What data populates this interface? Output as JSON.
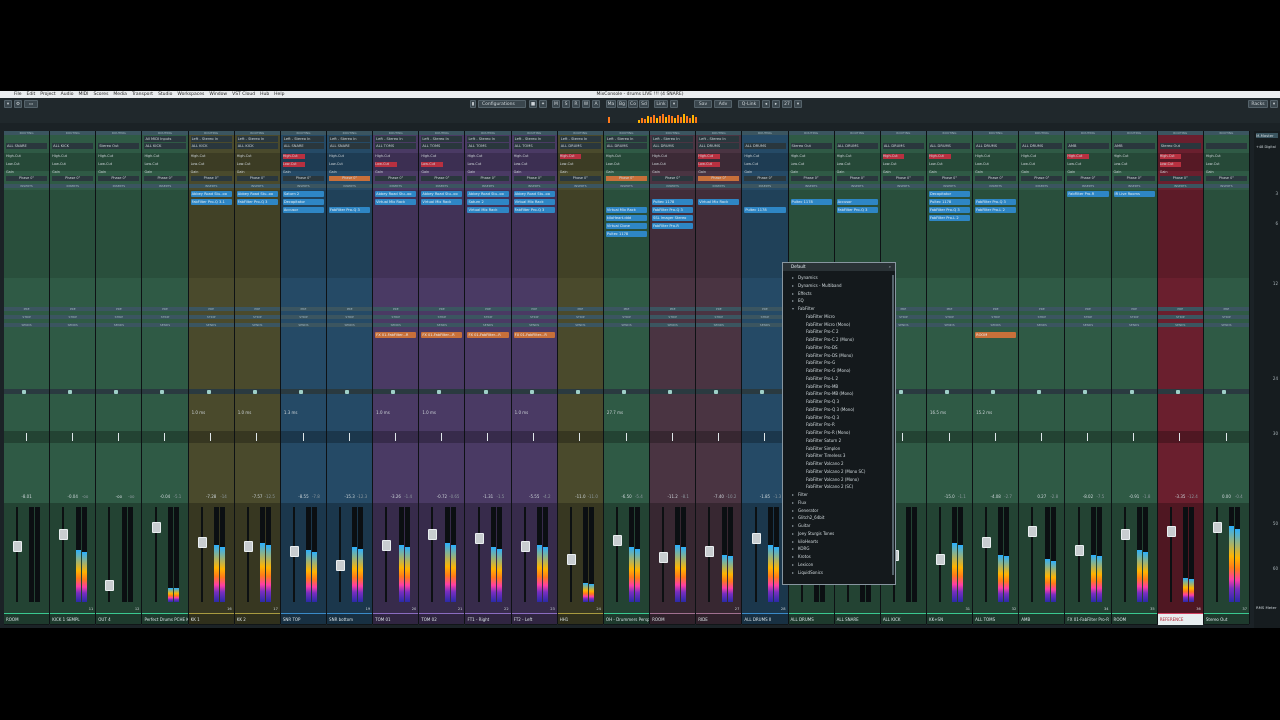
{
  "window": {
    "title": "MixConsole - drums LIVE !!! (4 SNARE)",
    "menu": [
      "File",
      "Edit",
      "Project",
      "Audio",
      "MIDI",
      "Scores",
      "Media",
      "Transport",
      "Studio",
      "Workspaces",
      "Window",
      "VST Cloud",
      "Hub",
      "Help"
    ]
  },
  "toolbar": {
    "configurations_label": "Configurations",
    "buttons": [
      "M",
      "S",
      "R",
      "W",
      "A"
    ],
    "right_label": "Racks",
    "link_label": "Link",
    "q_link_label": "Q-Link",
    "counter": "27",
    "group_labels": [
      "Ma",
      "Bg",
      "Co",
      "Sd"
    ],
    "window_buttons": [
      "Sav",
      "Adv"
    ],
    "meter_label": "Meter"
  },
  "colors": {
    "green": "#2f5a45",
    "green_dark": "#24463a",
    "olive": "#4a4a2c",
    "blue": "#254a66",
    "purple": "#4a3a64",
    "mauve": "#4a3442",
    "red": "#6a1f2e",
    "slot_blue": "#2e86c5",
    "slot_orange": "#c8703a",
    "red_cut": "#b83040"
  },
  "channels": [
    {
      "id": 1,
      "name": "ROOM",
      "routing": "ALL SNARE",
      "volume": "-8.01",
      "peak": "",
      "color": "green",
      "number": ""
    },
    {
      "id": 2,
      "name": "KICK 1 SEMPL",
      "routing": "ALL KICK",
      "volume": "-0.04",
      "peak": "-oo",
      "color": "green",
      "number": "11"
    },
    {
      "id": 3,
      "name": "OUT 4",
      "routing": "Stereo Out",
      "volume": "-oo",
      "peak": "-oo",
      "color": "green",
      "number": "12"
    },
    {
      "id": 4,
      "name": "Perfect Drums PCHE KICK",
      "routing": "ALL KICK",
      "input": "All MIDI Inputs",
      "volume": "-0.04",
      "peak": "-5.1",
      "color": "green",
      "number": ""
    },
    {
      "id": 5,
      "name": "KK 1",
      "routing": "ALL KICK",
      "input": "Left - Stereo In",
      "volume": "-7.28",
      "peak": "-14",
      "color": "olive",
      "number": "16"
    },
    {
      "id": 6,
      "name": "KK 2",
      "routing": "ALL KICK",
      "input": "Left - Stereo In",
      "volume": "-7.57",
      "peak": "-12.5",
      "color": "olive",
      "number": "17"
    },
    {
      "id": 7,
      "name": "SNR TOP",
      "routing": "ALL SNARE",
      "input": "Left - Stereo In",
      "volume": "-8.55",
      "peak": "-7.8",
      "color": "blue",
      "number": ""
    },
    {
      "id": 8,
      "name": "SNR bottom",
      "routing": "ALL SNARE",
      "input": "Left - Stereo In",
      "volume": "-15.3",
      "peak": "-12.3",
      "color": "blue",
      "number": "19"
    },
    {
      "id": 9,
      "name": "TOM 01",
      "routing": "ALL TOMS",
      "input": "Left - Stereo In",
      "volume": "-3.26",
      "peak": "-1.4",
      "color": "purple",
      "number": "20"
    },
    {
      "id": 10,
      "name": "TOM 02",
      "routing": "ALL TOMS",
      "input": "Left - Stereo In",
      "volume": "-0.72",
      "peak": "-0.65",
      "color": "purple",
      "number": "21"
    },
    {
      "id": 11,
      "name": "FT1 - Right",
      "routing": "ALL TOMS",
      "input": "Left - Stereo In",
      "volume": "-1.31",
      "peak": "-1.5",
      "color": "purple",
      "number": "22"
    },
    {
      "id": 12,
      "name": "FT2 - Left",
      "routing": "ALL TOMS",
      "input": "Left - Stereo In",
      "volume": "-5.55",
      "peak": "-4.2",
      "color": "purple",
      "number": "23"
    },
    {
      "id": 13,
      "name": "HH1",
      "routing": "ALL DRUMS",
      "input": "Left - Stereo In",
      "volume": "-11.0",
      "peak": "-11.0",
      "color": "olive",
      "number": "24"
    },
    {
      "id": 14,
      "name": "OH - Drummers Perspective",
      "routing": "ALL DRUMS",
      "input": "Left - Stereo In",
      "volume": "-6.50",
      "peak": "-5.4",
      "color": "green",
      "number": ""
    },
    {
      "id": 15,
      "name": "ROOM",
      "routing": "ALL DRUMS",
      "input": "Left - Stereo In",
      "volume": "-11.2",
      "peak": "-8.1",
      "color": "mauve",
      "number": ""
    },
    {
      "id": 16,
      "name": "RIDE",
      "routing": "ALL DRUMS",
      "input": "Left - Stereo In",
      "volume": "-7.40",
      "peak": "-10.2",
      "color": "mauve",
      "number": "27"
    },
    {
      "id": 17,
      "name": "ALL DRUMS II",
      "routing": "ALL DRUMS",
      "volume": "-1.85",
      "peak": "-1.3",
      "color": "blue",
      "number": "28"
    },
    {
      "id": 18,
      "name": "ALL DRUMS",
      "routing": "Stereo Out",
      "volume": "",
      "peak": "",
      "color": "green",
      "number": ""
    },
    {
      "id": 19,
      "name": "ALL SNARE",
      "routing": "ALL DRUMS",
      "volume": "",
      "peak": "",
      "color": "green",
      "number": ""
    },
    {
      "id": 20,
      "name": "ALL KICK",
      "routing": "ALL DRUMS",
      "volume": "",
      "peak": "",
      "color": "green",
      "number": ""
    },
    {
      "id": 21,
      "name": "KK+SN",
      "routing": "ALL DRUMS",
      "volume": "-15.0",
      "peak": "-1.1",
      "color": "green",
      "number": "31"
    },
    {
      "id": 22,
      "name": "ALL TOMS",
      "routing": "ALL DRUMS",
      "volume": "-4.08",
      "peak": "-2.7",
      "color": "green",
      "number": "32"
    },
    {
      "id": 23,
      "name": "AMB",
      "routing": "ALL DRUMS",
      "volume": "0.27",
      "peak": "-2.8",
      "color": "green",
      "number": ""
    },
    {
      "id": 24,
      "name": "FX 01-FabFilter Pro-R",
      "routing": "AMB",
      "volume": "-8.02",
      "peak": "-7.5",
      "color": "green",
      "number": "34"
    },
    {
      "id": 25,
      "name": "ROOM",
      "routing": "AMB",
      "volume": "-0.91",
      "peak": "-1.8",
      "color": "green",
      "number": "35"
    },
    {
      "id": 26,
      "name": "REFERENCE",
      "routing": "Stereo Out",
      "volume": "-3.35",
      "peak": "-12.4",
      "color": "red",
      "number": "36"
    },
    {
      "id": 27,
      "name": "Stereo Out",
      "routing": "",
      "volume": "0.00",
      "peak": "-0.4",
      "color": "green",
      "number": "37"
    }
  ],
  "insert_slots": [
    {
      "ch": 5,
      "row": 0,
      "label": "Abbey Road Stu..oo",
      "kind": "blue"
    },
    {
      "ch": 5,
      "row": 1,
      "label": "FabFilter Pro-Q 3-1",
      "kind": "blue"
    },
    {
      "ch": 6,
      "row": 0,
      "label": "Abbey Road Stu..oo",
      "kind": "blue"
    },
    {
      "ch": 6,
      "row": 1,
      "label": "FabFilter Pro-Q 3",
      "kind": "blue"
    },
    {
      "ch": 7,
      "row": 0,
      "label": "Saturn 2",
      "kind": "blue"
    },
    {
      "ch": 7,
      "row": 1,
      "label": "Decapitator",
      "kind": "blue"
    },
    {
      "ch": 7,
      "row": 2,
      "label": "Accusor",
      "kind": "blue"
    },
    {
      "ch": 8,
      "row": 2,
      "label": "FabFilter Pro-Q 3",
      "kind": "blue"
    },
    {
      "ch": 9,
      "row": 0,
      "label": "Abbey Road Stu..oo",
      "kind": "blue"
    },
    {
      "ch": 9,
      "row": 1,
      "label": "Virtual Mix Rack",
      "kind": "blue"
    },
    {
      "ch": 10,
      "row": 0,
      "label": "Abbey Road Stu..oo",
      "kind": "blue"
    },
    {
      "ch": 10,
      "row": 1,
      "label": "Virtual Mix Rack",
      "kind": "blue"
    },
    {
      "ch": 11,
      "row": 0,
      "label": "Abbey Road Stu..oo",
      "kind": "blue"
    },
    {
      "ch": 11,
      "row": 1,
      "label": "Saturn 2",
      "kind": "blue"
    },
    {
      "ch": 11,
      "row": 2,
      "label": "Virtual Mix Rack",
      "kind": "blue"
    },
    {
      "ch": 12,
      "row": 0,
      "label": "Abbey Road Stu..oo",
      "kind": "blue"
    },
    {
      "ch": 12,
      "row": 1,
      "label": "Virtual Mix Rack",
      "kind": "blue"
    },
    {
      "ch": 12,
      "row": 2,
      "label": "FabFilter Pro-Q 3",
      "kind": "blue"
    },
    {
      "ch": 14,
      "row": 2,
      "label": "Virtual Mix Rack",
      "kind": "blue"
    },
    {
      "ch": 14,
      "row": 3,
      "label": "kiloHeart.ddd",
      "kind": "blue"
    },
    {
      "ch": 14,
      "row": 4,
      "label": "Virtual Clone",
      "kind": "blue"
    },
    {
      "ch": 14,
      "row": 5,
      "label": "Pultec 1178",
      "kind": "blue"
    },
    {
      "ch": 15,
      "row": 1,
      "label": "Pultec 1178",
      "kind": "blue"
    },
    {
      "ch": 15,
      "row": 2,
      "label": "FabFilter Pro-Q 3",
      "kind": "blue"
    },
    {
      "ch": 15,
      "row": 3,
      "label": "SSL Imager Stereo",
      "kind": "blue"
    },
    {
      "ch": 15,
      "row": 4,
      "label": "FabFilter Pro-R",
      "kind": "blue"
    },
    {
      "ch": 16,
      "row": 1,
      "label": "Virtual Mix Rack",
      "kind": "blue"
    },
    {
      "ch": 17,
      "row": 2,
      "label": "Pultec 1178",
      "kind": "blue"
    },
    {
      "ch": 18,
      "row": 1,
      "label": "Pultec 1178",
      "kind": "blue"
    },
    {
      "ch": 19,
      "row": 1,
      "label": "Accusor",
      "kind": "blue"
    },
    {
      "ch": 19,
      "row": 2,
      "label": "FabFilter Pro-Q 3",
      "kind": "blue"
    },
    {
      "ch": 21,
      "row": 0,
      "label": "Decapitator",
      "kind": "blue"
    },
    {
      "ch": 21,
      "row": 1,
      "label": "Pultec 1178",
      "kind": "blue"
    },
    {
      "ch": 21,
      "row": 2,
      "label": "FabFilter Pro-Q 3",
      "kind": "blue"
    },
    {
      "ch": 21,
      "row": 3,
      "label": "FabFilter Pro-L 2",
      "kind": "blue"
    },
    {
      "ch": 22,
      "row": 1,
      "label": "FabFilter Pro-Q 3",
      "kind": "blue"
    },
    {
      "ch": 22,
      "row": 2,
      "label": "FabFilter Pro-L 2",
      "kind": "blue"
    },
    {
      "ch": 24,
      "row": 0,
      "label": "FabFilter Pro-R",
      "kind": "blue"
    },
    {
      "ch": 25,
      "row": 0,
      "label": "IR Live Rooms",
      "kind": "blue"
    }
  ],
  "send_slots": [
    {
      "ch": 9,
      "label": "FX 01-FabFilter...R"
    },
    {
      "ch": 10,
      "label": "FX 01-FabFilter...R"
    },
    {
      "ch": 11,
      "label": "FX 01-FabFilter...R"
    },
    {
      "ch": 12,
      "label": "FX 01-FabFilter...R"
    },
    {
      "ch": 22,
      "label": "ROOM"
    }
  ],
  "delay_labels": [
    {
      "ch": 5,
      "label": "1.0 ms"
    },
    {
      "ch": 6,
      "label": "1.0 ms"
    },
    {
      "ch": 7,
      "label": "1.3 ms"
    },
    {
      "ch": 9,
      "label": "1.0 ms"
    },
    {
      "ch": 10,
      "label": "1.0 ms"
    },
    {
      "ch": 12,
      "label": "1.0 ms"
    },
    {
      "ch": 14,
      "label": "27.7 ms"
    },
    {
      "ch": 21,
      "label": "16.5 ms"
    },
    {
      "ch": 22,
      "label": "15.2 ms"
    }
  ],
  "popup": {
    "header": "Default",
    "items": [
      {
        "label": "Dynamics",
        "level": 0,
        "type": "folder"
      },
      {
        "label": "Dynamics - Multiband",
        "level": 0,
        "type": "folder"
      },
      {
        "label": "Effects",
        "level": 0,
        "type": "folder"
      },
      {
        "label": "EQ",
        "level": 0,
        "type": "folder"
      },
      {
        "label": "FabFilter",
        "level": 0,
        "type": "open"
      },
      {
        "label": "FabFilter Micro",
        "level": 1,
        "type": "plugin"
      },
      {
        "label": "FabFilter Micro (Mono)",
        "level": 1,
        "type": "plugin"
      },
      {
        "label": "FabFilter Pro-C 2",
        "level": 1,
        "type": "plugin"
      },
      {
        "label": "FabFilter Pro-C 2 (Mono)",
        "level": 1,
        "type": "plugin"
      },
      {
        "label": "FabFilter Pro-DS",
        "level": 1,
        "type": "plugin"
      },
      {
        "label": "FabFilter Pro-DS (Mono)",
        "level": 1,
        "type": "plugin"
      },
      {
        "label": "FabFilter Pro-G",
        "level": 1,
        "type": "plugin"
      },
      {
        "label": "FabFilter Pro-G (Mono)",
        "level": 1,
        "type": "plugin"
      },
      {
        "label": "FabFilter Pro-L 2",
        "level": 1,
        "type": "plugin"
      },
      {
        "label": "FabFilter Pro-MB",
        "level": 1,
        "type": "plugin"
      },
      {
        "label": "FabFilter Pro-MB (Mono)",
        "level": 1,
        "type": "plugin"
      },
      {
        "label": "FabFilter Pro-Q 3",
        "level": 1,
        "type": "plugin"
      },
      {
        "label": "FabFilter Pro-Q 3 (Mono)",
        "level": 1,
        "type": "plugin"
      },
      {
        "label": "FabFilter Pro-Q 3",
        "level": 1,
        "type": "plugin"
      },
      {
        "label": "FabFilter Pro-R",
        "level": 1,
        "type": "plugin"
      },
      {
        "label": "FabFilter Pro-R (Mono)",
        "level": 1,
        "type": "plugin"
      },
      {
        "label": "FabFilter Saturn 2",
        "level": 1,
        "type": "plugin"
      },
      {
        "label": "FabFilter Simplon",
        "level": 1,
        "type": "plugin"
      },
      {
        "label": "FabFilter Timeless 3",
        "level": 1,
        "type": "plugin"
      },
      {
        "label": "FabFilter Volcano 2",
        "level": 1,
        "type": "plugin"
      },
      {
        "label": "FabFilter Volcano 2 (Mono SC)",
        "level": 1,
        "type": "plugin"
      },
      {
        "label": "FabFilter Volcano 2 (Mono)",
        "level": 1,
        "type": "plugin"
      },
      {
        "label": "FabFilter Volcano 2 (SC)",
        "level": 1,
        "type": "plugin"
      },
      {
        "label": "Filter",
        "level": 0,
        "type": "folder"
      },
      {
        "label": "Flux",
        "level": 0,
        "type": "folder"
      },
      {
        "label": "Generator",
        "level": 0,
        "type": "folder"
      },
      {
        "label": "Glitch2_64bit",
        "level": 0,
        "type": "folder"
      },
      {
        "label": "Guitar",
        "level": 0,
        "type": "folder"
      },
      {
        "label": "Joey Sturgis Tones",
        "level": 0,
        "type": "folder"
      },
      {
        "label": "kiloHearts",
        "level": 0,
        "type": "folder"
      },
      {
        "label": "KORG",
        "level": 0,
        "type": "folder"
      },
      {
        "label": "Krotos",
        "level": 0,
        "type": "folder"
      },
      {
        "label": "Lexicon",
        "level": 0,
        "type": "folder"
      },
      {
        "label": "LiquidSonics",
        "level": 0,
        "type": "folder"
      }
    ]
  },
  "ruler_ticks": [
    "3",
    "6",
    "12",
    "24",
    "30",
    "50",
    "60"
  ],
  "strip_labels": {
    "routing": "ROUTING",
    "inserts": "INSERTS",
    "sends": "SENDS",
    "pre": "PRE",
    "strip": "STRIP",
    "phase": "Phase 0°",
    "hicut": "High-Cut",
    "locut": "Low-Cut",
    "gain": "Gain"
  },
  "side_labels": {
    "master": "M-Master",
    "channels": "+48 Digital",
    "rms": "RMS Meter"
  }
}
